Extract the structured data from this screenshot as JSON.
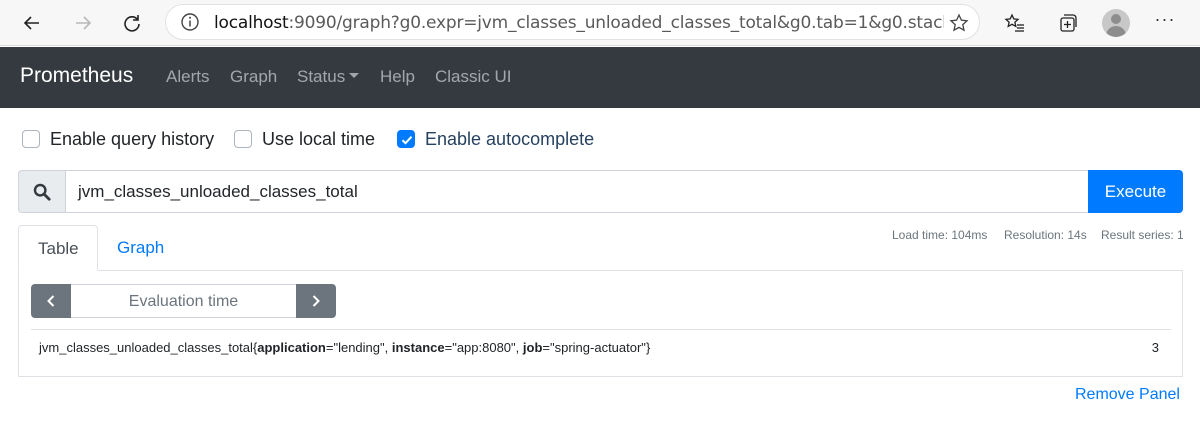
{
  "browser": {
    "url_host": "localhost",
    "url_rest": ":9090/graph?g0.expr=jvm_classes_unloaded_classes_total&g0.tab=1&g0.stacke...",
    "icons": [
      "back-icon",
      "forward-icon",
      "refresh-icon",
      "info-icon",
      "favorite-star-icon",
      "favorites-icon",
      "collections-icon",
      "profile-avatar",
      "more-icon"
    ],
    "more_label": "···"
  },
  "navbar": {
    "brand": "Prometheus",
    "links": [
      "Alerts",
      "Graph",
      "Status",
      "Help",
      "Classic UI"
    ]
  },
  "options": {
    "query_history": {
      "label": "Enable query history",
      "checked": false
    },
    "local_time": {
      "label": "Use local time",
      "checked": false
    },
    "autocomplete": {
      "label": "Enable autocomplete",
      "checked": true
    }
  },
  "query": {
    "expression": "jvm_classes_unloaded_classes_total",
    "execute_label": "Execute"
  },
  "stats": {
    "load_time": "Load time: 104ms",
    "resolution": "Resolution: 14s",
    "result_series": "Result series: 1"
  },
  "tabs": [
    "Table",
    "Graph"
  ],
  "active_tab": "Table",
  "table": {
    "evaluation_placeholder": "Evaluation time",
    "result": {
      "metric_name": "jvm_classes_unloaded_classes_total",
      "labels": [
        {
          "key": "application",
          "value": "\"lending\""
        },
        {
          "key": "instance",
          "value": "\"app:8080\""
        },
        {
          "key": "job",
          "value": "\"spring-actuator\""
        }
      ],
      "value": "3"
    }
  },
  "remove_panel_label": "Remove Panel",
  "colors": {
    "navbar_bg": "#343a40",
    "primary": "#007bff",
    "secondary": "#6c757d"
  }
}
